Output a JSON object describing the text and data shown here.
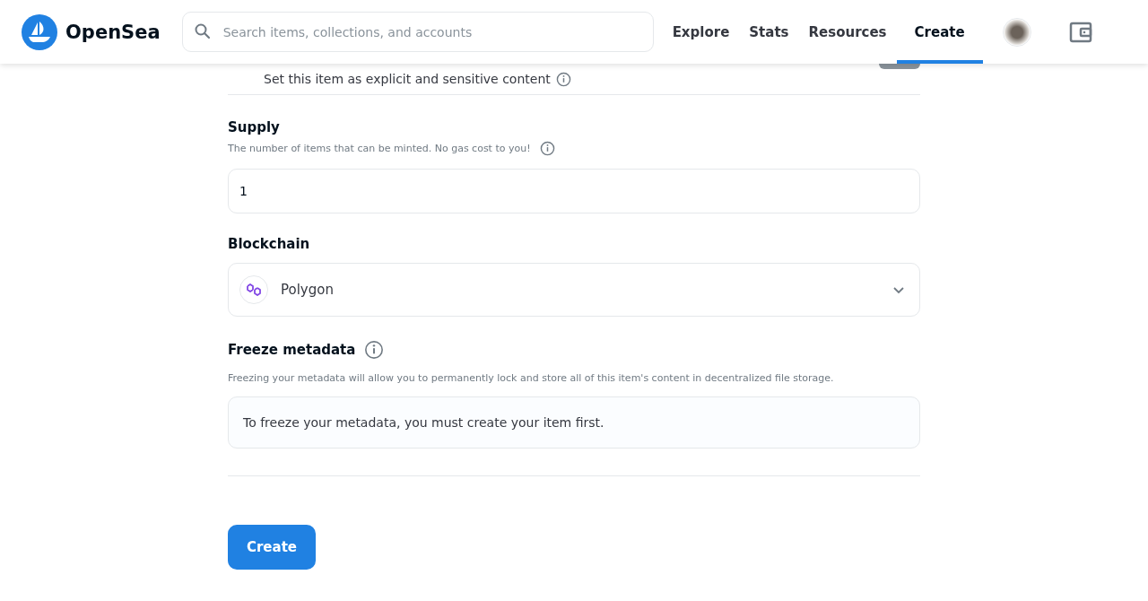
{
  "header": {
    "logo_text": "OpenSea",
    "search": {
      "placeholder": "Search items, collections, and accounts"
    },
    "nav": [
      {
        "label": "Explore",
        "selected": false
      },
      {
        "label": "Stats",
        "selected": false
      },
      {
        "label": "Resources",
        "selected": false
      },
      {
        "label": "Create",
        "selected": true
      }
    ]
  },
  "explicit": {
    "label": "Set this item as explicit and sensitive content",
    "on": false
  },
  "supply": {
    "title": "Supply",
    "hint": "The number of items that can be minted. No gas cost to you!",
    "value": "1"
  },
  "blockchain": {
    "title": "Blockchain",
    "value": "Polygon"
  },
  "freeze": {
    "title": "Freeze metadata",
    "hint": "Freezing your metadata will allow you to permanently lock and store all of this item's content in decentralized file storage.",
    "notice": "To freeze your metadata, you must create your item first."
  },
  "submit": {
    "label": "Create"
  }
}
